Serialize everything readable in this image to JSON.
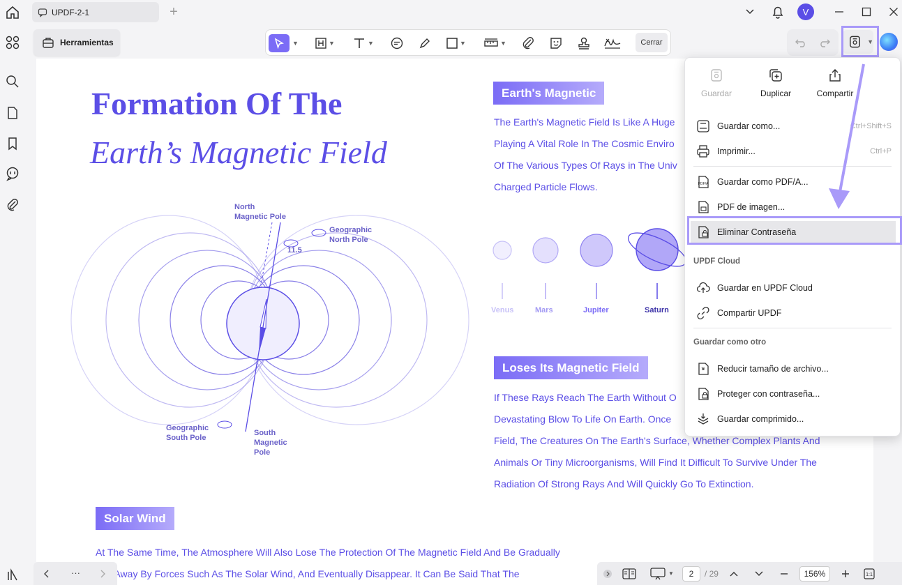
{
  "titlebar": {
    "tab_title": "UPDF-2-1",
    "new_tab": "+",
    "avatar_letter": "V"
  },
  "toolbar": {
    "herramientas": "Herramientas",
    "cerrar": "Cerrar"
  },
  "document": {
    "title_line1": "Formation Of The",
    "title_line2": "Earth’s Magnetic Field",
    "section1": {
      "heading": "Earth's Magnetic",
      "lines": [
        "The Earth's Magnetic Field Is Like A Huge",
        "Playing A Vital Role In The Cosmic Enviro",
        "Of The Various Types Of Rays in The Univ",
        "Charged Particle Flows."
      ]
    },
    "planets": [
      "Venus",
      "Mars",
      "Jupiter",
      "Saturn"
    ],
    "section2": {
      "heading": "Loses Its Magnetic Field",
      "lines": [
        "If These Rays Reach The Earth Without O",
        "Devastating Blow To Life On Earth. Once",
        "Field, The Creatures On The Earth's Surface, Whether Complex Plants And",
        "Animals Or Tiny Microorganisms, Will Find It Difficult To Survive Under The",
        "Radiation Of Strong Rays And Will Quickly Go To Extinction."
      ]
    },
    "section3": {
      "heading": "Solar Wind",
      "lines": [
        "At The Same Time, The Atmosphere Will Also Lose The Protection Of The Magnetic Field And Be Gradually",
        "ped Away By Forces Such As The Solar Wind, And Eventually Disappear. It Can Be Said That The"
      ]
    },
    "diagram": {
      "north_magnetic": [
        "North",
        "Magnetic Pole"
      ],
      "geo_north": [
        "Geographic",
        "North Pole"
      ],
      "angle": "11.5",
      "geo_south": [
        "Geographic",
        "South Pole"
      ],
      "south_magnetic": [
        "South",
        "Magnetic",
        "Pole"
      ]
    }
  },
  "menu": {
    "top": [
      {
        "label": "Guardar",
        "disabled": true
      },
      {
        "label": "Duplicar",
        "disabled": false
      },
      {
        "label": "Compartir",
        "disabled": false
      }
    ],
    "items": [
      {
        "label": "Guardar como...",
        "shortcut": "Ctrl+Shift+S"
      },
      {
        "label": "Imprimir...",
        "shortcut": "Ctrl+P"
      },
      {
        "label": "Guardar como PDF/A...",
        "shortcut": ""
      },
      {
        "label": "PDF de imagen...",
        "shortcut": ""
      },
      {
        "label": "Eliminar Contraseña",
        "shortcut": ""
      }
    ],
    "cloud_header": "UPDF Cloud",
    "cloud_items": [
      {
        "label": "Guardar en UPDF Cloud"
      },
      {
        "label": "Compartir UPDF"
      }
    ],
    "other_header": "Guardar como otro",
    "other_items": [
      {
        "label": "Reducir tamaño de archivo..."
      },
      {
        "label": "Proteger con contraseña..."
      },
      {
        "label": "Guardar comprimido..."
      }
    ]
  },
  "bottom": {
    "more": "···",
    "page_current": "2",
    "page_total": "/ 29",
    "zoom": "156%"
  },
  "colors": {
    "accent": "#5b4ee6",
    "highlight": "#a99af9"
  }
}
